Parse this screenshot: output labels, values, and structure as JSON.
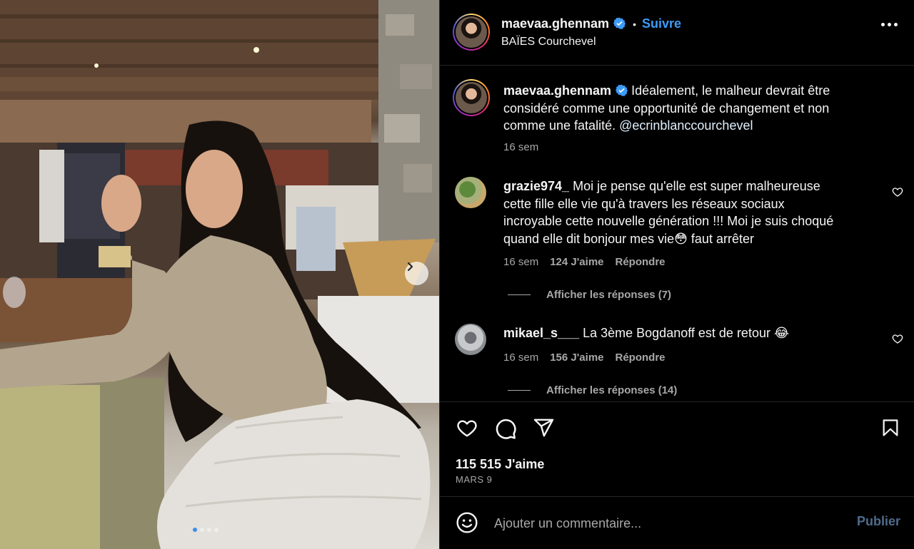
{
  "post": {
    "username": "maevaa.ghennam",
    "follow_label": "Suivre",
    "separator": "•",
    "location": "BAÏES Courchevel"
  },
  "caption": {
    "username": "maevaa.ghennam",
    "line1": "Idéalement, le malheur devrait être",
    "line2": "considéré comme une opportunité de changement et non",
    "line3_text": "comme une fatalité.",
    "line3_mention": "@ecrinblanccourchevel",
    "time": "16 sem"
  },
  "comments": [
    {
      "username": "grazie974_",
      "line1": "Moi je pense qu'elle est super malheureuse",
      "line2": "cette fille elle vie qu'à travers les réseaux sociaux",
      "line3": "incroyable cette nouvelle génération !!! Moi je suis choqué",
      "line4": "quand elle dit bonjour mes vie😳 faut arrêter",
      "time": "16 sem",
      "likes": "124 J'aime",
      "reply": "Répondre",
      "view_replies": "Afficher les réponses (7)"
    },
    {
      "username": "mikael_s___",
      "line1": "La 3ème Bogdanoff est de retour 😂",
      "time": "16 sem",
      "likes": "156 J'aime",
      "reply": "Répondre",
      "view_replies": "Afficher les réponses (14)"
    }
  ],
  "stats": {
    "likes": "115 515 J'aime",
    "date": "MARS 9"
  },
  "composer": {
    "placeholder": "Ajouter un commentaire...",
    "publish_label": "Publier"
  },
  "media": {
    "current_slide": 1,
    "total_slides": 4
  },
  "icons": {
    "verified": "verified-badge-icon",
    "more": "more-options-icon",
    "like": "heart-icon",
    "comment": "comment-icon",
    "share": "share-icon",
    "save": "bookmark-icon",
    "emoji": "emoji-icon",
    "next": "chevron-right-icon"
  },
  "colors": {
    "accent": "#3d9bf7",
    "verified": "#3d9bf7",
    "muted": "#a8a8a8",
    "background": "#000000"
  }
}
